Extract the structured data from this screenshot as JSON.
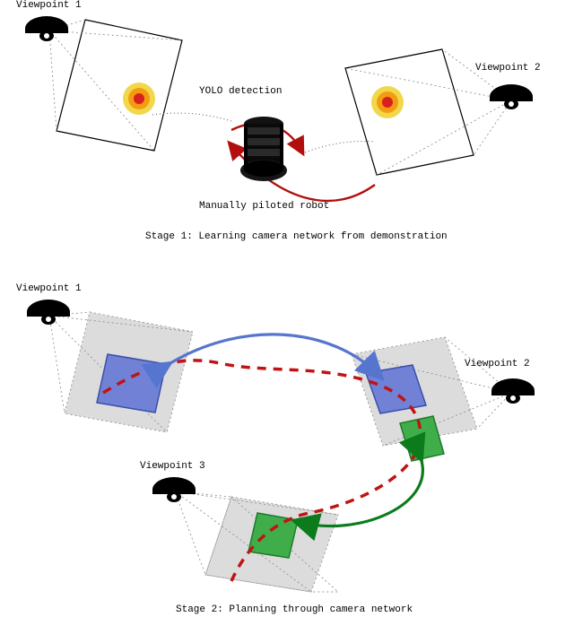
{
  "stage1": {
    "viewpoint1_label": "Viewpoint 1",
    "viewpoint2_label": "Viewpoint 2",
    "detection_label": "YOLO detection",
    "robot_label": "Manually piloted robot",
    "caption": "Stage 1:  Learning camera network from demonstration"
  },
  "stage2": {
    "viewpoint1_label": "Viewpoint 1",
    "viewpoint2_label": "Viewpoint 2",
    "viewpoint3_label": "Viewpoint 3",
    "caption": "Stage 2:  Planning through camera network"
  },
  "colors": {
    "blue_link": "#5675ce",
    "green_link": "#0b7b1b",
    "red_dash": "#c11313",
    "red_arrow": "#b30e0e",
    "gray_fill": "#dcdcdc",
    "gray_stroke": "#b8b8b8",
    "blue_rect": "#7081d6",
    "green_rect": "#3fae4a"
  }
}
